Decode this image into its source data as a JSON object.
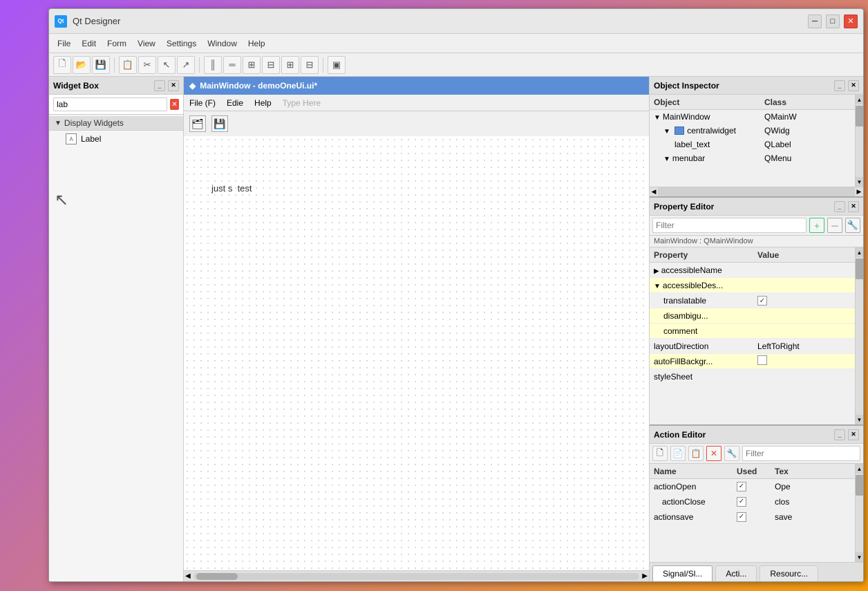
{
  "app": {
    "title": "Qt Designer",
    "icon_label": "Qt"
  },
  "title_bar": {
    "title": "Qt Designer",
    "minimize_label": "─",
    "maximize_label": "□",
    "close_label": "✕"
  },
  "menu_bar": {
    "items": [
      "File",
      "Edit",
      "Form",
      "View",
      "Settings",
      "Window",
      "Help"
    ]
  },
  "toolbar": {
    "buttons": [
      "🗋",
      "💾",
      "📋",
      "◻",
      "⊞",
      "↘",
      "↗",
      "🔲",
      "║",
      "═",
      "⊟",
      "⊞",
      "⊟",
      "⊞",
      "▣"
    ]
  },
  "widget_box": {
    "title": "Widget Box",
    "search_placeholder": "lab",
    "search_value": "lab",
    "groups": [
      {
        "name": "Display Widgets",
        "expanded": true,
        "items": [
          {
            "label": "Label"
          }
        ]
      }
    ]
  },
  "form_window": {
    "title": "MainWindow - demoOneUi.ui*",
    "icon": "◆",
    "menu_items": [
      "File (F)",
      "Edie",
      "Help",
      "Type Here"
    ],
    "canvas_text": "just s  test",
    "toolbar_icons": [
      "🗂",
      "💾"
    ]
  },
  "object_inspector": {
    "title": "Object Inspector",
    "columns": [
      "Object",
      "Class"
    ],
    "rows": [
      {
        "label": "MainWindow",
        "class": "QMainW",
        "level": 0,
        "expanded": true
      },
      {
        "label": "centralwidget",
        "class": "QWidg",
        "level": 1,
        "expanded": true,
        "has_icon": true
      },
      {
        "label": "label_text",
        "class": "QLabel",
        "level": 2
      },
      {
        "label": "menubar",
        "class": "QMenu",
        "level": 1,
        "expanded": true
      }
    ]
  },
  "property_editor": {
    "title": "Property Editor",
    "filter_placeholder": "Filter",
    "context": "MainWindow : QMainWindow",
    "columns": [
      "Property",
      "Value"
    ],
    "rows": [
      {
        "name": "accessibleName",
        "value": "",
        "type": "collapsed",
        "highlight": false
      },
      {
        "name": "accessibleDes...",
        "value": "",
        "type": "expanded",
        "highlight": true
      },
      {
        "name": "translatable",
        "value": "✓",
        "value_type": "checkbox",
        "checked": true,
        "indent": 1,
        "highlight": false
      },
      {
        "name": "disambigu...",
        "value": "",
        "indent": 1,
        "highlight": false
      },
      {
        "name": "comment",
        "value": "",
        "indent": 1,
        "highlight": false
      },
      {
        "name": "layoutDirection",
        "value": "LeftToRight",
        "highlight": true
      },
      {
        "name": "autoFillBackgr...",
        "value": "□",
        "value_type": "checkbox",
        "checked": false,
        "highlight": false
      },
      {
        "name": "styleSheet",
        "value": "",
        "highlight": false
      }
    ]
  },
  "action_editor": {
    "title": "Action Editor",
    "filter_placeholder": "Filter",
    "columns": [
      "Name",
      "Used",
      "Tex"
    ],
    "rows": [
      {
        "name": "actionOpen",
        "used": true,
        "text": "Ope"
      },
      {
        "name": "actionClose",
        "used": true,
        "text": "clos",
        "indent": true
      },
      {
        "name": "actionsave",
        "used": true,
        "text": "save"
      }
    ],
    "toolbar_buttons": [
      "🗋",
      "📄",
      "📋",
      "✕",
      "🔧"
    ]
  },
  "bottom_tabs": {
    "tabs": [
      "Signal/Sl...",
      "Acti...",
      "Resourc..."
    ],
    "active": 0
  }
}
